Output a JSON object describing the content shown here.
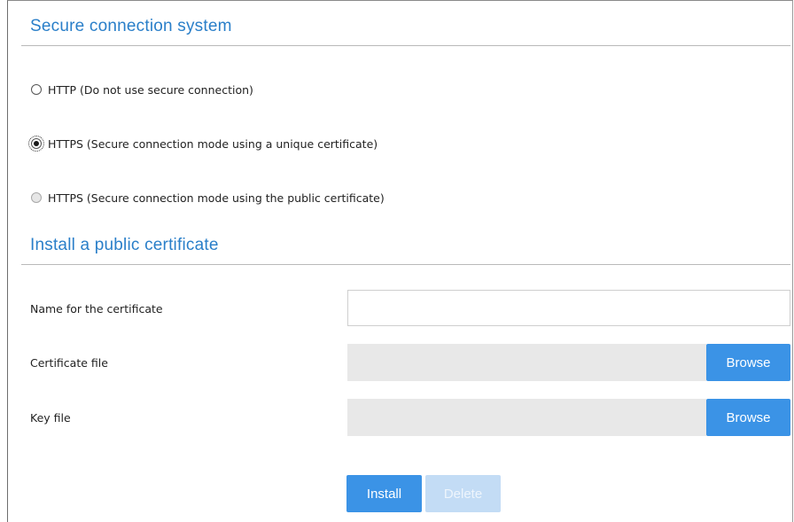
{
  "secure_connection": {
    "title": "Secure connection system",
    "options": [
      {
        "label": "HTTP (Do not use secure connection)",
        "checked": false,
        "disabled": false
      },
      {
        "label": "HTTPS (Secure connection mode using a unique certificate)",
        "checked": true,
        "disabled": false
      },
      {
        "label": "HTTPS (Secure connection mode using the public certificate)",
        "checked": false,
        "disabled": true
      }
    ]
  },
  "install_certificate": {
    "title": "Install a public certificate",
    "name_label": "Name for the certificate",
    "name_value": "",
    "certificate_file_label": "Certificate file",
    "key_file_label": "Key file",
    "browse_label": "Browse",
    "install_label": "Install",
    "delete_label": "Delete"
  },
  "colors": {
    "accent": "#3b93e6",
    "title": "#2a7fc9",
    "disabled_button": "#c3dcf5"
  }
}
